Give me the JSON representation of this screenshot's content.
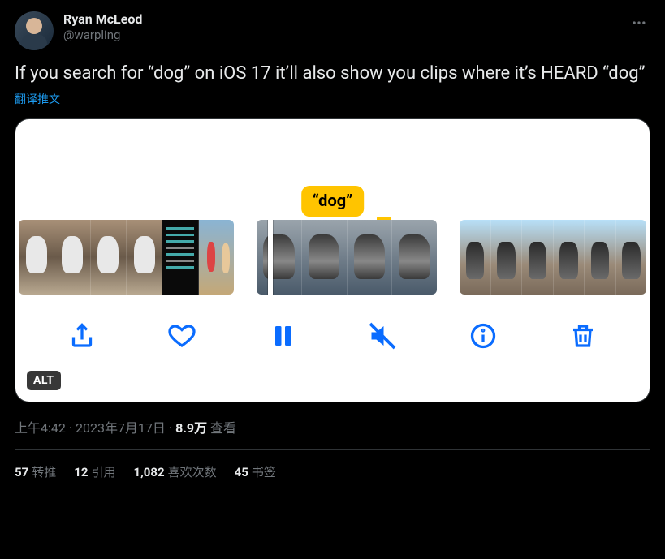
{
  "author": {
    "display_name": "Ryan McLeod",
    "handle": "@warpling"
  },
  "tweet_text": "If you search for “dog” on iOS 17 it’ll also show you clips where it’s HEARD “dog”",
  "translate_label": "翻译推文",
  "bubble_text": "“dog”",
  "alt_label": "ALT",
  "meta": {
    "time": "上午4:42",
    "date": "2023年7月17日",
    "views_count": "8.9万",
    "views_label": "查看",
    "sep": " · "
  },
  "engagement": {
    "retweets": {
      "count": "57",
      "label": "转推"
    },
    "quotes": {
      "count": "12",
      "label": "引用"
    },
    "likes": {
      "count": "1,082",
      "label": "喜欢次数"
    },
    "bookmarks": {
      "count": "45",
      "label": "书签"
    }
  }
}
